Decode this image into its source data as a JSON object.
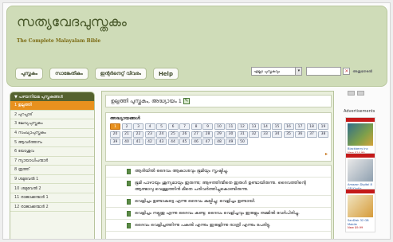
{
  "header": {
    "site_title": "സത്യവേദപുസ്തകം",
    "site_subtitle": "The Complete Malayalam Bible"
  },
  "nav": {
    "items": [
      {
        "label": "പുസ്തകം"
      },
      {
        "label": "സാങ്കേതികം"
      },
      {
        "label": "ഇന്റർനെറ്റ് വിവരം"
      },
      {
        "label": "Help"
      }
    ]
  },
  "search": {
    "select_value": "എല്ലാ പുസ്തകവും",
    "button_icon": "search-icon",
    "advanced_label": "അതുതേടൽ"
  },
  "sidebar": {
    "header": "▼ പഴയനിയമ പുസ്തകങ്ങൾ",
    "books": [
      "1 ഉല്പത്തി",
      "2 പുറപ്പാട്",
      "3 ലേവ്യപുസ്തകം",
      "4 സംഖ്യാപുസ്തകം",
      "5 ആവർത്തനം",
      "6 യോശുവ",
      "7 ന്യായാധിപന്മാർ",
      "8 രൂത്ത്",
      "9 ശമുവേൽ 1",
      "10 ശമുവേൽ 2",
      "11 രാജാക്കന്മാർ 1",
      "12 രാജാക്കന്മാർ 2"
    ],
    "active_index": 0
  },
  "main": {
    "title": "ഉല്പത്തി പുസ്തകം, അദ്ധ്യായം 1",
    "chapters_label": "അദ്ധ്യായങ്ങൾ",
    "chapters": [
      "1",
      "2",
      "3",
      "4",
      "5",
      "6",
      "7",
      "8",
      "9",
      "10",
      "11",
      "12",
      "13",
      "14",
      "15",
      "16",
      "17",
      "18",
      "19",
      "20",
      "21",
      "22",
      "23",
      "24",
      "25",
      "26",
      "27",
      "28",
      "29",
      "30",
      "31",
      "32",
      "33",
      "34",
      "35",
      "36",
      "37",
      "38",
      "39",
      "40",
      "41",
      "42",
      "43",
      "44",
      "45",
      "46",
      "47",
      "48",
      "49",
      "50"
    ],
    "active_chapter": "1",
    "next_arrow": "▸",
    "verses": [
      "ആദിയിൽ ദൈവം ആകാശവും ഭൂമിയും സൃഷ്ടിച്ചു.",
      "ഭൂമി പാഴായും ശൂന്യമായും ഇരുന്നു; ആഴത്തിന്മീതെ ഇരുൾ ഉണ്ടായിരുന്നു. ദൈവത്തിന്റെ ആത്മാവു വെള്ളത്തിൻ മീതെ പരിവർത്തിച്ചുകൊണ്ടിരുന്നു.",
      "വെളിച്ചം ഉണ്ടാകട്ടെ എന്നു ദൈവം കല്പിച്ചു; വെളിച്ചം ഉണ്ടായി.",
      "വെളിച്ചം നല്ലതു എന്നു ദൈവം കണ്ടു; ദൈവം വെളിച്ചവും ഇരുളും തമ്മിൽ വേർപിരിച്ചു.",
      "ദൈവം വെളിച്ചത്തിന്നു പകൽ എന്നും ഇരുളിന്നു രാത്രി എന്നും പേരിട്ടു."
    ]
  },
  "ads": {
    "title": "Advertisements",
    "items": [
      {
        "brand": "",
        "text": "Blackberry Inc",
        "price": "New $14.99"
      },
      {
        "brand": "",
        "text": "Amazon Digital 8 GB Kindle",
        "price": "New $3.37"
      },
      {
        "brand": "",
        "text": "SanDisk 32 GB Mobile",
        "price": "New $9.99"
      }
    ]
  }
}
